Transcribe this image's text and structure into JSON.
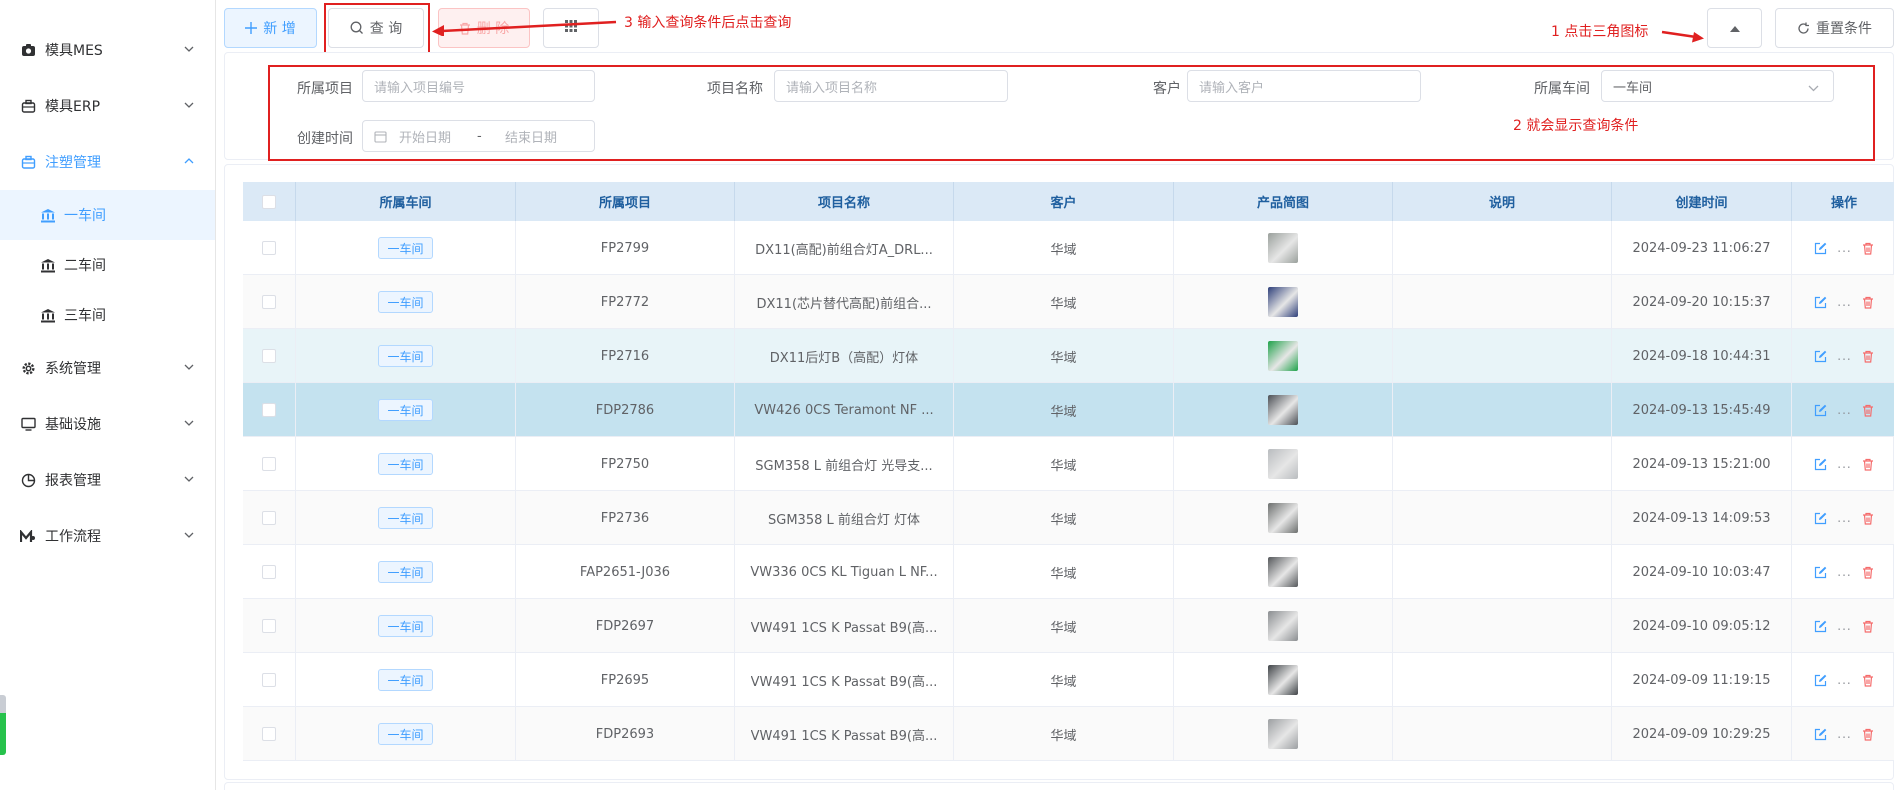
{
  "sidebar": {
    "items": [
      {
        "label": "模具MES",
        "icon": "camera-icon"
      },
      {
        "label": "模具ERP",
        "icon": "briefcase-icon"
      },
      {
        "label": "注塑管理",
        "icon": "box-icon",
        "expanded": true
      },
      {
        "label": "系统管理",
        "icon": "gear-icon"
      },
      {
        "label": "基础设施",
        "icon": "monitor-icon"
      },
      {
        "label": "报表管理",
        "icon": "pie-chart-icon"
      },
      {
        "label": "工作流程",
        "icon": "workflow-icon"
      }
    ],
    "sub_items": [
      {
        "label": "一车间",
        "icon": "bank-icon",
        "active": true
      },
      {
        "label": "二车间",
        "icon": "bank-icon"
      },
      {
        "label": "三车间",
        "icon": "bank-icon"
      }
    ]
  },
  "toolbar": {
    "add_label": "新 增",
    "query_label": "查 询",
    "delete_label": "删 除",
    "reset_label": "重置条件"
  },
  "annotations": {
    "step1": "1 点击三角图标",
    "step2": "2 就会显示查询条件",
    "step3": "3 输入查询条件后点击查询"
  },
  "search": {
    "project_label": "所属项目",
    "project_placeholder": "请输入项目编号",
    "name_label": "项目名称",
    "name_placeholder": "请输入项目名称",
    "customer_label": "客户",
    "customer_placeholder": "请输入客户",
    "workshop_label": "所属车间",
    "workshop_value": "一车间",
    "created_label": "创建时间",
    "start_placeholder": "开始日期",
    "date_sep": "-",
    "end_placeholder": "结束日期"
  },
  "table": {
    "headers": [
      "所属车间",
      "所属项目",
      "项目名称",
      "客户",
      "产品简图",
      "说明",
      "创建时间",
      "操作"
    ],
    "rows": [
      {
        "workshop": "一车间",
        "project": "FP2799",
        "name": "DX11(高配)前组合灯A_DRL...",
        "customer": "华域",
        "note": "",
        "created": "2024-09-23 11:06:27",
        "thumb_color": "#9aa09c"
      },
      {
        "workshop": "一车间",
        "project": "FP2772",
        "name": "DX11(芯片替代高配)前组合...",
        "customer": "华域",
        "note": "",
        "created": "2024-09-20 10:15:37",
        "thumb_color": "#2e3f7a"
      },
      {
        "workshop": "一车间",
        "project": "FP2716",
        "name": "DX11后灯B（高配）灯体",
        "customer": "华域",
        "note": "",
        "created": "2024-09-18 10:44:31",
        "thumb_color": "#1fa24a"
      },
      {
        "workshop": "一车间",
        "project": "FDP2786",
        "name": "VW426 0CS Teramont NF ...",
        "customer": "华域",
        "note": "",
        "created": "2024-09-13 15:45:49",
        "thumb_color": "#4b4f55"
      },
      {
        "workshop": "一车间",
        "project": "FP2750",
        "name": "SGM358 L 前组合灯 光导支...",
        "customer": "华域",
        "note": "",
        "created": "2024-09-13 15:21:00",
        "thumb_color": "#b9bcbf"
      },
      {
        "workshop": "一车间",
        "project": "FP2736",
        "name": "SGM358 L 前组合灯 灯体",
        "customer": "华域",
        "note": "",
        "created": "2024-09-13 14:09:53",
        "thumb_color": "#6c6f6e"
      },
      {
        "workshop": "一车间",
        "project": "FAP2651-J036",
        "name": "VW336 0CS KL Tiguan L NF...",
        "customer": "华域",
        "note": "",
        "created": "2024-09-10 10:03:47",
        "thumb_color": "#55585b"
      },
      {
        "workshop": "一车间",
        "project": "FDP2697",
        "name": "VW491 1CS K Passat B9(高...",
        "customer": "华域",
        "note": "",
        "created": "2024-09-10 09:05:12",
        "thumb_color": "#8a8d90"
      },
      {
        "workshop": "一车间",
        "project": "FP2695",
        "name": "VW491 1CS K Passat B9(高...",
        "customer": "华域",
        "note": "",
        "created": "2024-09-09 11:19:15",
        "thumb_color": "#3f4347"
      },
      {
        "workshop": "一车间",
        "project": "FDP2693",
        "name": "VW491 1CS K Passat B9(高...",
        "customer": "华域",
        "note": "",
        "created": "2024-09-09 10:29:25",
        "thumb_color": "#9c9fa2"
      }
    ]
  },
  "colors": {
    "primary": "#409eff",
    "danger": "#f56c6c",
    "annotation": "#e02020",
    "header_bg": "#dbe9f6"
  }
}
